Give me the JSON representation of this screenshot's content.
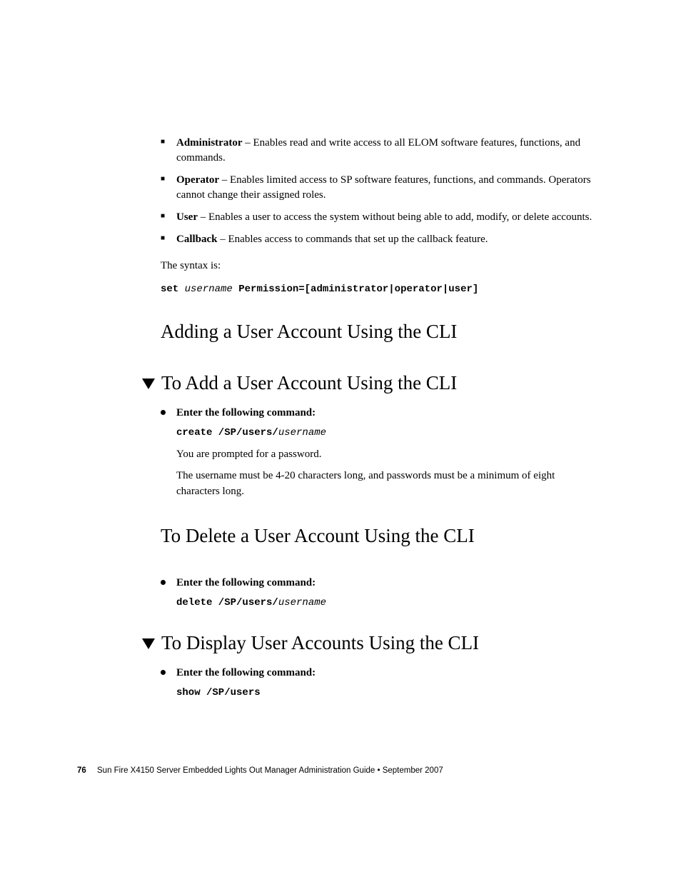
{
  "roles": [
    {
      "name": "Administrator",
      "desc": " – Enables read and write access to all ELOM software features, functions, and commands."
    },
    {
      "name": "Operator",
      "desc": " – Enables limited access to SP software features, functions, and commands. Operators cannot change their assigned roles."
    },
    {
      "name": "User",
      "desc": " – Enables a user to access the system without being able to add, modify, or delete accounts."
    },
    {
      "name": "Callback",
      "desc": " – Enables access to commands that set up the callback feature."
    }
  ],
  "syntax_intro": "The syntax is:",
  "syntax": {
    "kw": "set ",
    "var": "username ",
    "rest": "Permission=[administrator|operator|user]"
  },
  "sections": {
    "adding_h": "Adding a User Account Using the CLI",
    "to_add_h": "To Add a User Account Using the CLI",
    "to_delete_h": "To Delete a User Account Using the CLI",
    "to_display_h": "To Display User Accounts Using the CLI"
  },
  "steps": {
    "enter_cmd": "Enter the following command:",
    "cmd_create_b": "create /SP/users/",
    "cmd_create_i": "username",
    "add_note1": "You are prompted for a password.",
    "add_note2": "The username must be 4-20 characters long, and passwords must be a minimum of eight characters long.",
    "cmd_delete_b": "delete /SP/users/",
    "cmd_delete_i": "username",
    "cmd_show_b": "show /SP/users"
  },
  "footer": {
    "page": "76",
    "text": "Sun Fire X4150 Server Embedded Lights Out Manager Administration Guide • September 2007"
  }
}
